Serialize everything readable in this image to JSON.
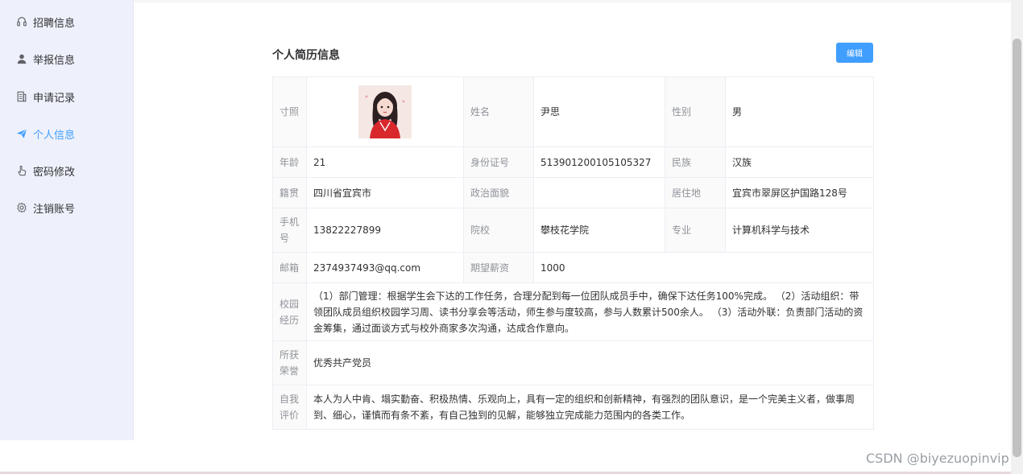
{
  "sidebar": {
    "items": [
      {
        "label": "招聘信息",
        "icon": "headset-icon",
        "active": false
      },
      {
        "label": "举报信息",
        "icon": "user-icon",
        "active": false
      },
      {
        "label": "申请记录",
        "icon": "document-icon",
        "active": false
      },
      {
        "label": "个人信息",
        "icon": "paper-plane-icon",
        "active": true
      },
      {
        "label": "密码修改",
        "icon": "pointer-hand-icon",
        "active": false
      },
      {
        "label": "注销账号",
        "icon": "gear-icon",
        "active": false
      }
    ]
  },
  "page": {
    "title": "个人简历信息",
    "edit_label": "编辑"
  },
  "resume": {
    "photo_label": "寸照",
    "name_label": "姓名",
    "name": "尹思",
    "gender_label": "性别",
    "gender": "男",
    "age_label": "年龄",
    "age": "21",
    "id_label": "身份证号",
    "id_number": "513901200105105327",
    "ethnicity_label": "民族",
    "ethnicity": "汉族",
    "origin_label": "籍贯",
    "origin": "四川省宜宾市",
    "political_label": "政治面貌",
    "political": "",
    "residence_label": "居住地",
    "residence": "宜宾市翠屏区护国路128号",
    "phone_label": "手机号",
    "phone": "13822227899",
    "school_label": "院校",
    "school": "攀枝花学院",
    "major_label": "专业",
    "major": "计算机科学与技术",
    "email_label": "邮箱",
    "email": "2374937493@qq.com",
    "salary_label": "期望薪资",
    "salary": "1000",
    "campus_label": "校园经历",
    "campus": "（1）部门管理：根据学生会下达的工作任务，合理分配到每一位团队成员手中，确保下达任务100%完成。 （2）活动组织：带领团队成员组织校园学习周、读书分享会等活动，师生参与度较高，参与人数累计500余人。 （3）活动外联：负责部门活动的资金筹集，通过面谈方式与校外商家多次沟通，达成合作意向。",
    "honor_label": "所获荣誉",
    "honor": "优秀共产党员",
    "self_label": "自我评价",
    "self_eval": "本人为人中肯、塌实勤奋、积极热情、乐观向上，具有一定的组织和创新精神，有强烈的团队意识，是一个完美主义者，做事周到、细心，谨慎而有条不紊，有自己独到的见解，能够独立完成能力范围内的各类工作。"
  },
  "watermark": "CSDN @biyezuopinvip",
  "colors": {
    "accent": "#409eff",
    "sidebar_bg": "#eef1fb"
  }
}
